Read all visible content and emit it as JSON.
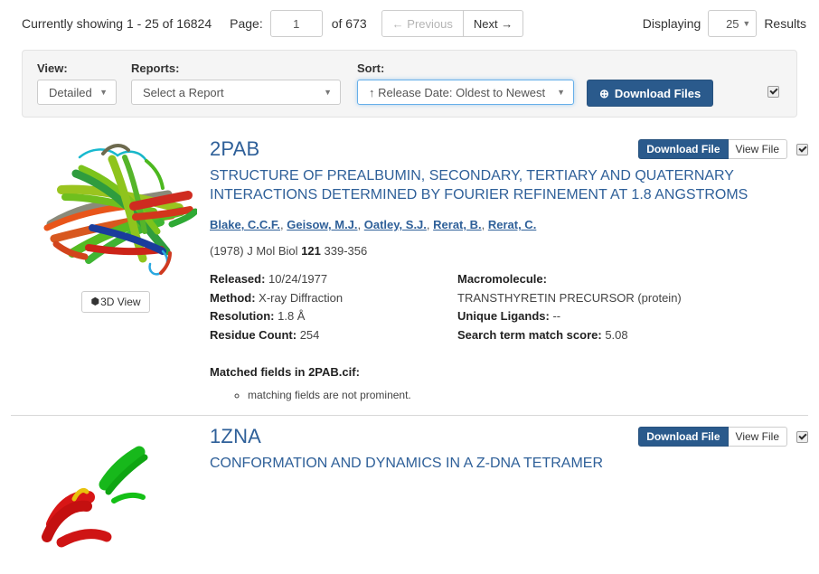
{
  "pagination": {
    "showing_text": "Currently showing 1 - 25 of 16824",
    "page_label": "Page:",
    "page_value": "1",
    "of_text": "of 673",
    "previous_label": "← Previous",
    "next_label": "Next →",
    "displaying_label": "Displaying",
    "results_per_page": "25",
    "results_label": "Results",
    "caret_icon": "▼"
  },
  "controls": {
    "view_label": "View:",
    "view_value": "Detailed",
    "reports_label": "Reports:",
    "reports_value": "Select a Report",
    "sort_label": "Sort:",
    "sort_value": "↑ Release Date: Oldest to Newest",
    "download_files_label": "Download Files",
    "download_icon": "⊕",
    "caret_icon": "▼",
    "select_all_checked": true
  },
  "buttons": {
    "download_file": "Download File",
    "view_file": "View File",
    "three_d_view": "3D View",
    "cube_icon": "⬢"
  },
  "colors": {
    "accent_blue": "#2a5a8c",
    "link_blue": "#2f6099",
    "panel_bg": "#f5f5f5",
    "panel_border": "#e3e3e3"
  },
  "entries": [
    {
      "pdb_id": "2PAB",
      "title": "STRUCTURE OF PREALBUMIN, SECONDARY, TERTIARY AND QUATERNARY INTERACTIONS DETERMINED BY FOURIER REFINEMENT AT 1.8 ANGSTROMS",
      "authors": [
        "Blake, C.C.F.",
        "Geisow, M.J.",
        "Oatley, S.J.",
        "Rerat, B.",
        "Rerat, C."
      ],
      "citation_year": "(1978)",
      "citation_journal": "J Mol Biol",
      "citation_volume": "121",
      "citation_pages": "339-356",
      "meta_left": [
        {
          "label": "Released:",
          "value": "10/24/1977"
        },
        {
          "label": "Method:",
          "value": "X-ray Diffraction"
        },
        {
          "label": "Resolution:",
          "value": "1.8 Å"
        },
        {
          "label": "Residue Count:",
          "value": "254"
        }
      ],
      "meta_right": [
        {
          "label": "Macromolecule:",
          "value": ""
        },
        {
          "label": "",
          "value": "TRANSTHYRETIN PRECURSOR (protein)"
        },
        {
          "label": "Unique Ligands:",
          "value": "--"
        },
        {
          "label": "Search term match score:",
          "value": "5.08"
        }
      ],
      "matched_fields_heading": "Matched fields in 2PAB.cif:",
      "matched_fields": [
        "matching fields are not prominent."
      ],
      "checked": true
    },
    {
      "pdb_id": "1ZNA",
      "title": "CONFORMATION AND DYNAMICS IN A Z-DNA TETRAMER",
      "checked": true
    }
  ]
}
